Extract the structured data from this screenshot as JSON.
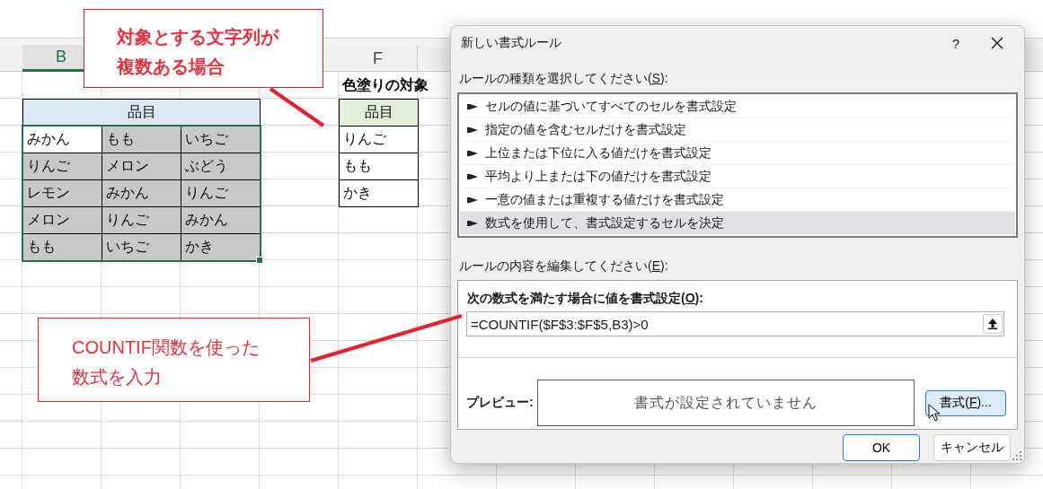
{
  "column_headers": [
    {
      "label": "B",
      "selected": true
    },
    {
      "label": "F",
      "selected": false
    }
  ],
  "sheet": {
    "title_cell": "色塗りの対象",
    "table": {
      "header": "品目",
      "rows": [
        [
          {
            "text": "みかん",
            "highlighted": false
          },
          {
            "text": "もも",
            "highlighted": true
          },
          {
            "text": "いちご",
            "highlighted": true
          }
        ],
        [
          {
            "text": "りんご",
            "highlighted": true
          },
          {
            "text": "メロン",
            "highlighted": true
          },
          {
            "text": "ぶどう",
            "highlighted": true
          }
        ],
        [
          {
            "text": "レモン",
            "highlighted": true
          },
          {
            "text": "みかん",
            "highlighted": true
          },
          {
            "text": "りんご",
            "highlighted": true
          }
        ],
        [
          {
            "text": "メロン",
            "highlighted": true
          },
          {
            "text": "りんご",
            "highlighted": true
          },
          {
            "text": "みかん",
            "highlighted": true
          }
        ],
        [
          {
            "text": "もも",
            "highlighted": true
          },
          {
            "text": "いちご",
            "highlighted": true
          },
          {
            "text": "かき",
            "highlighted": true
          }
        ]
      ]
    },
    "target_list": {
      "header": "品目",
      "items": [
        "りんご",
        "もも",
        "かき"
      ]
    }
  },
  "callouts": [
    {
      "lines": [
        "対象とする文字列が",
        "複数ある場合"
      ],
      "bold": true
    },
    {
      "lines": [
        "COUNTIF関数を使った",
        "数式を入力"
      ],
      "bold": false
    }
  ],
  "dialog": {
    "title": "新しい書式ルール",
    "help": "?",
    "rule_type_label": {
      "before": "ルールの種類を選択してください(",
      "key": "S",
      "after": "):"
    },
    "rule_types": [
      {
        "text": "セルの値に基づいてすべてのセルを書式設定",
        "selected": false
      },
      {
        "text": "指定の値を含むセルだけを書式設定",
        "selected": false
      },
      {
        "text": "上位または下位に入る値だけを書式設定",
        "selected": false
      },
      {
        "text": "平均より上または下の値だけを書式設定",
        "selected": false
      },
      {
        "text": "一意の値または重複する値だけを書式設定",
        "selected": false
      },
      {
        "text": "数式を使用して、書式設定するセルを決定",
        "selected": true
      }
    ],
    "edit_label": {
      "before": "ルールの内容を編集してください(",
      "key": "E",
      "after": "):"
    },
    "formula_label": {
      "before": "次の数式を満たす場合に値を書式設定(",
      "key": "O",
      "after": "):"
    },
    "formula": "=COUNTIF($F$3:$F$5,B3)>0",
    "preview_label": "プレビュー:",
    "preview_text": "書式が設定されていません",
    "format_button": {
      "before": "書式(",
      "key": "F",
      "after": ")..."
    },
    "buttons": [
      {
        "label": "OK",
        "default": true
      },
      {
        "label": "キャンセル",
        "default": false
      }
    ]
  }
}
